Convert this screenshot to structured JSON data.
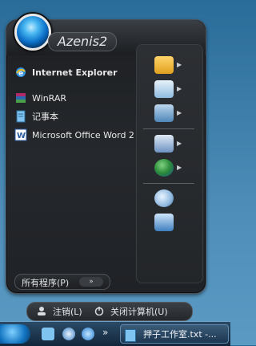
{
  "header": {
    "username": "Azenis2"
  },
  "pinned": [
    {
      "label": "Internet Explorer",
      "icon": "internet-explorer-icon"
    }
  ],
  "recent": [
    {
      "label": "WinRAR",
      "icon": "winrar-icon"
    },
    {
      "label": "记事本",
      "icon": "notepad-icon"
    },
    {
      "label": "Microsoft Office Word 2...",
      "icon": "word-icon"
    }
  ],
  "right_icons": [
    "folder-icon",
    "clock-document-icon",
    "computer-icon",
    "control-panel-icon",
    "network-globe-icon",
    "search-icon",
    "run-icon"
  ],
  "all_programs": {
    "label": "所有程序(P)",
    "arrow": "»"
  },
  "footer": {
    "logoff_label": "注销(L)",
    "shutdown_label": "关闭计算机(U)"
  },
  "taskbar": {
    "quicklaunch_more": "»",
    "task_label": "押子工作室.txt -..."
  },
  "colors": {
    "accent": "#0b6fc8",
    "menu_bg": "#1f2226",
    "desktop": "#4d8db8"
  }
}
